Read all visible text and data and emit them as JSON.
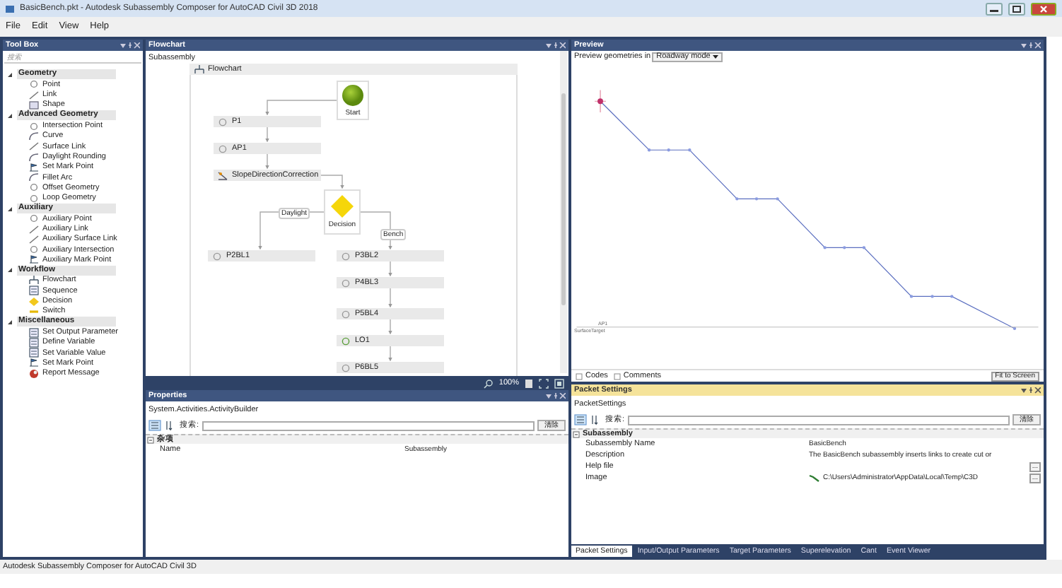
{
  "window": {
    "title": "BasicBench.pkt - Autodesk Subassembly Composer for AutoCAD Civil 3D 2018"
  },
  "menu": [
    "File",
    "Edit",
    "View",
    "Help"
  ],
  "toolbox": {
    "title": "Tool Box",
    "search": {
      "placeholder": "搜索"
    },
    "categories": [
      {
        "name": "Geometry",
        "expanded": true,
        "items": [
          {
            "label": "Point",
            "kind": "point"
          },
          {
            "label": "Link",
            "kind": "link"
          },
          {
            "label": "Shape",
            "kind": "shape"
          }
        ]
      },
      {
        "name": "Advanced Geometry",
        "expanded": true,
        "items": [
          {
            "label": "Intersection Point",
            "kind": "point"
          },
          {
            "label": "Curve",
            "kind": "curve"
          },
          {
            "label": "Surface Link",
            "kind": "link"
          },
          {
            "label": "Daylight Rounding",
            "kind": "curve"
          },
          {
            "label": "Set Mark Point",
            "kind": "flag"
          },
          {
            "label": "Fillet Arc",
            "kind": "curve"
          },
          {
            "label": "Offset Geometry",
            "kind": "point"
          },
          {
            "label": "Loop Geometry",
            "kind": "point"
          }
        ]
      },
      {
        "name": "Auxiliary",
        "expanded": true,
        "items": [
          {
            "label": "Auxiliary Point",
            "kind": "point"
          },
          {
            "label": "Auxiliary Link",
            "kind": "link"
          },
          {
            "label": "Auxiliary Surface Link",
            "kind": "link"
          },
          {
            "label": "Auxiliary Intersection",
            "kind": "point"
          },
          {
            "label": "Auxiliary Mark Point",
            "kind": "flag"
          }
        ]
      },
      {
        "name": "Workflow",
        "expanded": true,
        "items": [
          {
            "label": "Flowchart",
            "kind": "flow"
          },
          {
            "label": "Sequence",
            "kind": "list"
          },
          {
            "label": "Decision",
            "kind": "diamond"
          },
          {
            "label": "Switch",
            "kind": "switch"
          }
        ]
      },
      {
        "name": "Miscellaneous",
        "expanded": true,
        "items": [
          {
            "label": "Set Output Parameter",
            "kind": "list"
          },
          {
            "label": "Define Variable",
            "kind": "list"
          },
          {
            "label": "Set Variable Value",
            "kind": "list"
          },
          {
            "label": "Set Mark Point",
            "kind": "flag"
          },
          {
            "label": "Report Message",
            "kind": "report"
          }
        ]
      }
    ]
  },
  "flowchart": {
    "title": "Flowchart",
    "breadcrumb": "Subassembly",
    "container": "Flowchart",
    "nodes": [
      {
        "label": "Start",
        "kind": "start"
      },
      {
        "label": "P1",
        "kind": "point"
      },
      {
        "label": "AP1",
        "kind": "point"
      },
      {
        "label": "SlopeDirectionCorrection",
        "kind": "macro"
      },
      {
        "label": "Decision",
        "kind": "decision"
      },
      {
        "label": "P2BL1",
        "kind": "point"
      },
      {
        "label": "P3BL2",
        "kind": "point"
      },
      {
        "label": "P4BL3",
        "kind": "point"
      },
      {
        "label": "P5BL4",
        "kind": "point"
      },
      {
        "label": "LO1",
        "kind": "link"
      },
      {
        "label": "P6BL5",
        "kind": "point"
      }
    ],
    "branches": [
      "Daylight",
      "Bench"
    ],
    "zoom": "100%"
  },
  "properties": {
    "title": "Properties",
    "subtitle": "System.Activities.ActivityBuilder",
    "sort_buttons": [
      {
        "kind": "categorized",
        "selected": true
      },
      {
        "kind": "alphabetical",
        "selected": false
      }
    ],
    "search_label": "搜索:",
    "clear_button": "清除",
    "category": "杂项",
    "rows": [
      {
        "name": "Name",
        "value": "Subassembly"
      }
    ]
  },
  "preview": {
    "title": "Preview",
    "mode_label": "Preview geometries in",
    "mode": "Roadway mode",
    "target_labels": [
      "AP1",
      "SurfaceTarget"
    ],
    "checkboxes": [
      {
        "label": "Codes",
        "checked": false
      },
      {
        "label": "Comments",
        "checked": false
      }
    ],
    "fit_button": "Fit to Screen"
  },
  "packet_settings": {
    "title": "Packet Settings",
    "subtitle": "PacketSettings",
    "search_label": "搜索:",
    "clear_button": "清除",
    "category": "Subassembly",
    "rows": [
      {
        "name": "Subassembly Name",
        "value": "BasicBench"
      },
      {
        "name": "Description",
        "value": "The BasicBench subassembly inserts links to create cut or"
      },
      {
        "name": "Help file",
        "browse": "..."
      },
      {
        "name": "Image",
        "value": "C:\\Users\\Administrator\\AppData\\Local\\Temp\\C3D",
        "browse": "..."
      }
    ],
    "tabs": [
      {
        "label": "Packet Settings",
        "selected": true
      },
      {
        "label": "Input/Output Parameters",
        "selected": false
      },
      {
        "label": "Target Parameters",
        "selected": false
      },
      {
        "label": "Superelevation",
        "selected": false
      },
      {
        "label": "Cant",
        "selected": false
      },
      {
        "label": "Event Viewer",
        "selected": false
      }
    ]
  },
  "status_bar": "Autodesk Subassembly Composer for AutoCAD Civil 3D"
}
